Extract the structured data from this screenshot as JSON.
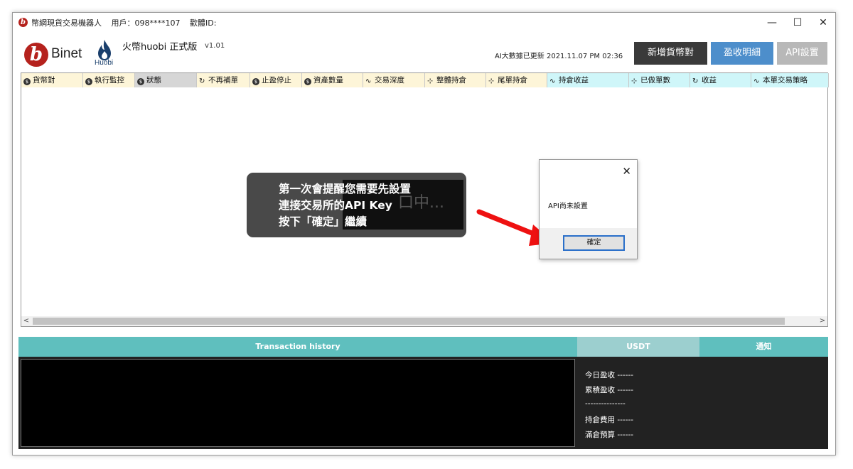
{
  "titlebar": {
    "app_icon_letter": "b",
    "app_title": "幣網現貨交易機器人",
    "user": "用戶：098****107",
    "device": "歡體ID:",
    "minimize": "—",
    "maximize": "☐",
    "close": "✕"
  },
  "header": {
    "logo_letter": "b",
    "logo_text": "Binet",
    "huobi_text": "Huobi",
    "app_name": "火幣huobi 正式版",
    "version": "v1.01",
    "update_info": "AI大數據已更新  2021.11.07 PM 02:36",
    "buttons": [
      {
        "label": "新增貨幣對",
        "color": "#3a3a3a"
      },
      {
        "label": "盈收明細",
        "color": "#4d8ecb"
      },
      {
        "label": "API設置",
        "color": "#b8b8b8"
      }
    ]
  },
  "table": {
    "columns": [
      {
        "label": "貨幣對",
        "icon": "coin-icon",
        "bg": "#fdf5d8"
      },
      {
        "label": "執行監控",
        "icon": "coin-icon",
        "bg": "#fdf5d8"
      },
      {
        "label": "狀態",
        "icon": "coin-icon",
        "bg": "#d6d6d6"
      },
      {
        "label": "不再補單",
        "icon": "refresh-icon",
        "bg": "#fdf5d8"
      },
      {
        "label": "止盈停止",
        "icon": "coin-icon",
        "bg": "#fdf5d8"
      },
      {
        "label": "資產數量",
        "icon": "coin-icon",
        "bg": "#fdf5d8"
      },
      {
        "label": "交易深度",
        "icon": "chart-icon",
        "bg": "#fdf5d8"
      },
      {
        "label": "整體持倉",
        "icon": "network-icon",
        "bg": "#fdf5d8"
      },
      {
        "label": "尾單持倉",
        "icon": "network-icon",
        "bg": "#fdf5d8"
      },
      {
        "label": "持倉收益",
        "icon": "chart-icon",
        "bg": "#cff6f9"
      },
      {
        "label": "已做單數",
        "icon": "network-icon",
        "bg": "#cff6f9"
      },
      {
        "label": "收益",
        "icon": "refresh-icon",
        "bg": "#cff6f9"
      },
      {
        "label": "本單交易策略",
        "icon": "chart-icon",
        "bg": "#cff6f9"
      }
    ],
    "scroll_left": "<",
    "scroll_right": ">"
  },
  "toast": {
    "line1": "第一次會提醒您需要先設置",
    "line2": "連接交易所的API Key",
    "line3": "按下「確定」繼續",
    "underlay": "口中..."
  },
  "dialog": {
    "close": "✕",
    "message": "API尚未設置",
    "ok_label": "確定"
  },
  "bottom": {
    "tabs": [
      {
        "label": "Transaction history",
        "color": "#5fbfbe"
      },
      {
        "label": "USDT",
        "color": "#9ccfcf"
      },
      {
        "label": "通知",
        "color": "#5fbfbe"
      }
    ],
    "stats": [
      "今日盈收 ------",
      "累積盈收 ------",
      "---------------",
      "持倉費用 ------",
      "滿倉預算 ------"
    ]
  }
}
